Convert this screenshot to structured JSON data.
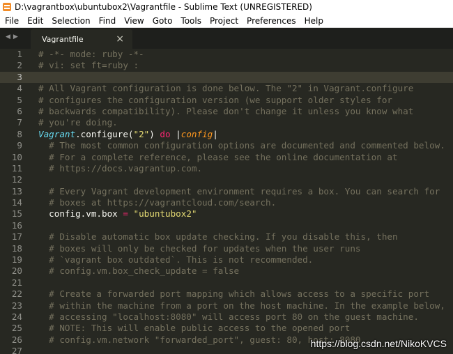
{
  "window": {
    "title": "D:\\vagrantbox\\ubuntubox2\\Vagrantfile - Sublime Text (UNREGISTERED)",
    "icon": "sublime-text-icon"
  },
  "menu": [
    "File",
    "Edit",
    "Selection",
    "Find",
    "View",
    "Goto",
    "Tools",
    "Project",
    "Preferences",
    "Help"
  ],
  "tabbar": {
    "arrows": [
      "◀",
      "▶"
    ],
    "active_tab": {
      "label": "Vagrantfile",
      "close": "×"
    }
  },
  "editor": {
    "current_line": 3,
    "colors": {
      "background": "#272822",
      "comment": "#75715e",
      "plain": "#f8f8f2",
      "class": "#66d9ef",
      "string": "#e6db74",
      "keyword": "#f92672",
      "param": "#fd971f"
    },
    "lines": [
      {
        "n": "1",
        "tokens": [
          {
            "t": "comment",
            "v": "# -*- mode: ruby -*-"
          }
        ]
      },
      {
        "n": "2",
        "tokens": [
          {
            "t": "comment",
            "v": "# vi: set ft=ruby :"
          }
        ]
      },
      {
        "n": "3",
        "tokens": []
      },
      {
        "n": "4",
        "tokens": [
          {
            "t": "comment",
            "v": "# All Vagrant configuration is done below. The \"2\" in Vagrant.configure"
          }
        ]
      },
      {
        "n": "5",
        "tokens": [
          {
            "t": "comment",
            "v": "# configures the configuration version (we support older styles for"
          }
        ]
      },
      {
        "n": "6",
        "tokens": [
          {
            "t": "comment",
            "v": "# backwards compatibility). Please don't change it unless you know what"
          }
        ]
      },
      {
        "n": "7",
        "tokens": [
          {
            "t": "comment",
            "v": "# you're doing."
          }
        ]
      },
      {
        "n": "8",
        "tokens": [
          {
            "t": "class",
            "v": "Vagrant"
          },
          {
            "t": "plain",
            "v": ".configure("
          },
          {
            "t": "string",
            "v": "\"2\""
          },
          {
            "t": "plain",
            "v": ") "
          },
          {
            "t": "keyword",
            "v": "do"
          },
          {
            "t": "plain",
            "v": " |"
          },
          {
            "t": "param",
            "v": "config"
          },
          {
            "t": "plain",
            "v": "|"
          }
        ]
      },
      {
        "n": "9",
        "tokens": [
          {
            "t": "comment",
            "v": "  # The most common configuration options are documented and commented below."
          }
        ]
      },
      {
        "n": "10",
        "tokens": [
          {
            "t": "comment",
            "v": "  # For a complete reference, please see the online documentation at"
          }
        ]
      },
      {
        "n": "11",
        "tokens": [
          {
            "t": "comment",
            "v": "  # https://docs.vagrantup.com."
          }
        ]
      },
      {
        "n": "12",
        "tokens": []
      },
      {
        "n": "13",
        "tokens": [
          {
            "t": "comment",
            "v": "  # Every Vagrant development environment requires a box. You can search for"
          }
        ]
      },
      {
        "n": "14",
        "tokens": [
          {
            "t": "comment",
            "v": "  # boxes at https://vagrantcloud.com/search."
          }
        ]
      },
      {
        "n": "15",
        "tokens": [
          {
            "t": "plain",
            "v": "  config.vm.box "
          },
          {
            "t": "keyword",
            "v": "="
          },
          {
            "t": "plain",
            "v": " "
          },
          {
            "t": "string",
            "v": "\"ubuntubox2\""
          }
        ]
      },
      {
        "n": "16",
        "tokens": []
      },
      {
        "n": "17",
        "tokens": [
          {
            "t": "comment",
            "v": "  # Disable automatic box update checking. If you disable this, then"
          }
        ]
      },
      {
        "n": "18",
        "tokens": [
          {
            "t": "comment",
            "v": "  # boxes will only be checked for updates when the user runs"
          }
        ]
      },
      {
        "n": "19",
        "tokens": [
          {
            "t": "comment",
            "v": "  # `vagrant box outdated`. This is not recommended."
          }
        ]
      },
      {
        "n": "20",
        "tokens": [
          {
            "t": "comment",
            "v": "  # config.vm.box_check_update = false"
          }
        ]
      },
      {
        "n": "21",
        "tokens": []
      },
      {
        "n": "22",
        "tokens": [
          {
            "t": "comment",
            "v": "  # Create a forwarded port mapping which allows access to a specific port"
          }
        ]
      },
      {
        "n": "23",
        "tokens": [
          {
            "t": "comment",
            "v": "  # within the machine from a port on the host machine. In the example below,"
          }
        ]
      },
      {
        "n": "24",
        "tokens": [
          {
            "t": "comment",
            "v": "  # accessing \"localhost:8080\" will access port 80 on the guest machine."
          }
        ]
      },
      {
        "n": "25",
        "tokens": [
          {
            "t": "comment",
            "v": "  # NOTE: This will enable public access to the opened port"
          }
        ]
      },
      {
        "n": "26",
        "tokens": [
          {
            "t": "comment",
            "v": "  # config.vm.network \"forwarded_port\", guest: 80, host: 8080"
          }
        ]
      },
      {
        "n": "27",
        "tokens": []
      }
    ]
  },
  "watermark": "https://blog.csdn.net/NikoKVCS"
}
